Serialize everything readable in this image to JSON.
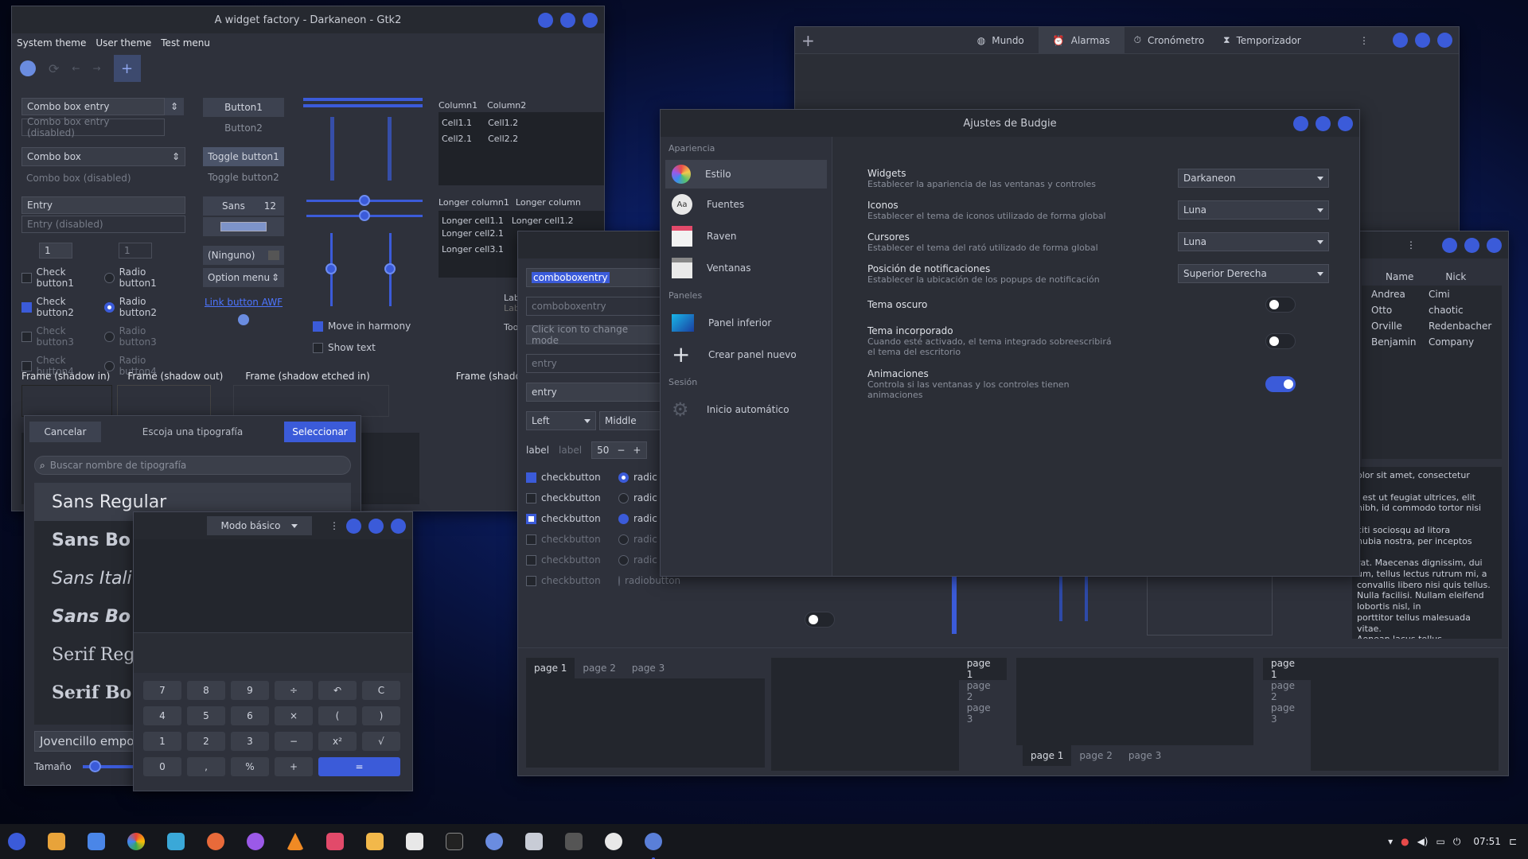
{
  "widget_factory": {
    "title": "A widget factory - Darkaneon - Gtk2",
    "menu": [
      "System theme",
      "User theme",
      "Test menu"
    ],
    "combo_entry": "Combo box entry",
    "combo_entry_dis": "Combo box entry (disabled)",
    "combo": "Combo box",
    "combo_dis": "Combo box (disabled)",
    "entry": "Entry",
    "entry_dis": "Entry (disabled)",
    "spin1": "1",
    "spin2": "1",
    "checks": [
      "Check button1",
      "Check button2",
      "Check button3",
      "Check button4"
    ],
    "radios": [
      "Radio button1",
      "Radio button2",
      "Radio button3",
      "Radio button4"
    ],
    "button1": "Button1",
    "button2": "Button2",
    "toggle1": "Toggle button1",
    "toggle2": "Toggle button2",
    "font_name": "Sans",
    "font_size": "12",
    "ninguno": "(Ninguno)",
    "option_menu": "Option menu",
    "link": "Link button AWF",
    "move_harmony": "Move in harmony",
    "show_text": "Show text",
    "col1": "Column1",
    "col2": "Column2",
    "cells": [
      [
        "Cell1.1",
        "Cell1.2"
      ],
      [
        "Cell2.1",
        "Cell2.2"
      ]
    ],
    "long_col1": "Longer column1",
    "long_col2": "Longer column",
    "long_cells": [
      "Longer cell1.1",
      "Longer cell2.1",
      "Longer cell3.1"
    ],
    "long_cell12": "Longer cell1.2",
    "lab": "Lab",
    "lab2": "Lab",
    "too": "Too",
    "frames": [
      "Frame (shadow in)",
      "Frame (shadow out)",
      "Frame (shadow etched in)",
      "Frame (shadow etched"
    ]
  },
  "font_dialog": {
    "cancel": "Cancelar",
    "title": "Escoja una tipografía",
    "select": "Seleccionar",
    "search": "Buscar nombre de tipografía",
    "fonts": [
      "Sans Regular",
      "Sans Bo",
      "Sans Itali",
      "Sans Bo",
      "Serif Reg",
      "Serif Bo"
    ],
    "preview": "Jovencillo empo",
    "size_label": "Tamaño"
  },
  "calculator": {
    "mode": "Modo básico",
    "keys": [
      [
        "7",
        "8",
        "9",
        "÷",
        "↶",
        "C"
      ],
      [
        "4",
        "5",
        "6",
        "×",
        "(",
        ")"
      ],
      [
        "1",
        "2",
        "3",
        "−",
        "x²",
        "√"
      ],
      [
        "0",
        ",",
        "%",
        "+",
        "="
      ]
    ]
  },
  "clocks": {
    "tabs": [
      "Mundo",
      "Alarmas",
      "Cronómetro",
      "Temporizador"
    ],
    "active": "Alarmas"
  },
  "gtk3": {
    "comboboxentry": "comboboxentry",
    "comboboxentry_dis": "comboboxentry",
    "click_icon": "Click icon to change mode",
    "entry_dis": "entry",
    "entry": "entry",
    "left": "Left",
    "middle": "Middle",
    "label1": "label",
    "label2": "label",
    "spin": "50",
    "checkbutton": "checkbutton",
    "radio": "radic",
    "radiobutton": "radiobutton",
    "names_header": [
      "Name",
      "Nick"
    ],
    "names": [
      [
        "Andrea",
        "Cimi"
      ],
      [
        "Otto",
        "chaotic"
      ],
      [
        "Orville",
        "Redenbacher"
      ],
      [
        "Benjamin",
        "Company"
      ]
    ],
    "lorem": "olor sit amet, consectetur\n\n, est ut feugiat ultrices, elit\nnibh, id commodo tortor nisi\n\nciti sociosqu ad litora\nnubia nostra, per inceptos\n\nrat. Maecenas dignissim, dui\num, tellus lectus rutrum mi, a\nconvallis libero nisi quis tellus.\nNulla facilisi. Nullam eleifend lobortis nisl, in\nporttitor tellus malesuada vitae.\nAenean lacus tellus, pellentesque quis\nmolestie quis, fringilla in arcu.\nDuis elementum, tellus sed tristique semper",
    "pages": [
      "page 1",
      "page 2",
      "page 3"
    ]
  },
  "budgie": {
    "title": "Ajustes de Budgie",
    "sections": {
      "appearance": "Apariencia",
      "panels": "Paneles",
      "session": "Sesión"
    },
    "items": [
      "Estilo",
      "Fuentes",
      "Raven",
      "Ventanas",
      "Panel inferior",
      "Crear panel nuevo",
      "Inicio automático"
    ],
    "settings": [
      {
        "title": "Widgets",
        "desc": "Establecer la apariencia de las ventanas y controles",
        "value": "Darkaneon"
      },
      {
        "title": "Iconos",
        "desc": "Establecer el tema de iconos utilizado de forma global",
        "value": "Luna"
      },
      {
        "title": "Cursores",
        "desc": "Establecer el tema del rató utilizado de forma global",
        "value": "Luna"
      },
      {
        "title": "Posición de notificaciones",
        "desc": "Establecer la ubicación de los popups de notificación",
        "value": "Superior Derecha"
      }
    ],
    "toggles": [
      {
        "title": "Tema oscuro",
        "desc": "",
        "on": false
      },
      {
        "title": "Tema incorporado",
        "desc": "Cuando esté activado, el tema integrado sobreescribirá el tema del escritorio",
        "on": false
      },
      {
        "title": "Animaciones",
        "desc": "Controla si las ventanas y los controles tienen animaciones",
        "on": true
      }
    ]
  },
  "taskbar": {
    "clock": "07:51"
  }
}
